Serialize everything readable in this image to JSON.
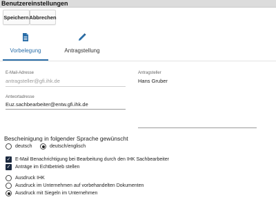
{
  "window": {
    "title": "Benutzereinstellungen"
  },
  "toolbar": {
    "save_label": "Speichern",
    "cancel_label": "Abbrechen"
  },
  "tabs": [
    {
      "label": "Vorbelegung",
      "icon": "document-icon",
      "active": true
    },
    {
      "label": "Antragstellung",
      "icon": "pencil-icon",
      "active": false
    }
  ],
  "form": {
    "email": {
      "label": "E-Mail-Adresse",
      "value": "antragsteller@gfi.ihk.de"
    },
    "reply": {
      "label": "Antwortadresse",
      "value": "Euz.sachbearbeiter@entw.gfi.ihk.de"
    },
    "applicant": {
      "label": "Antragsteller",
      "value": "Hans Gruber"
    }
  },
  "language": {
    "title": "Bescheinigung in folgender Sprache gewünscht",
    "options": [
      {
        "label": "deutsch",
        "selected": false
      },
      {
        "label": "deutsch/englisch",
        "selected": true
      }
    ]
  },
  "checkboxes": [
    {
      "label": "E-Mail Benachrichtigung bei Bearbeitung durch den IHK Sachbearbeiter",
      "checked": true
    },
    {
      "label": "Anträge im Echtbetrieb stellen",
      "checked": true
    }
  ],
  "print_options": [
    {
      "label": "Ausdruck IHK",
      "selected": false
    },
    {
      "label": "Ausdruck im Unternehmen auf vorbehandelten Dokumenten",
      "selected": false
    },
    {
      "label": "Ausdruck mit Siegeln im Unternehmen",
      "selected": true
    }
  ],
  "colors": {
    "accent": "#2a6ea8",
    "checkbox": "#1c2a40",
    "titlebar": "#dcdcdc"
  }
}
